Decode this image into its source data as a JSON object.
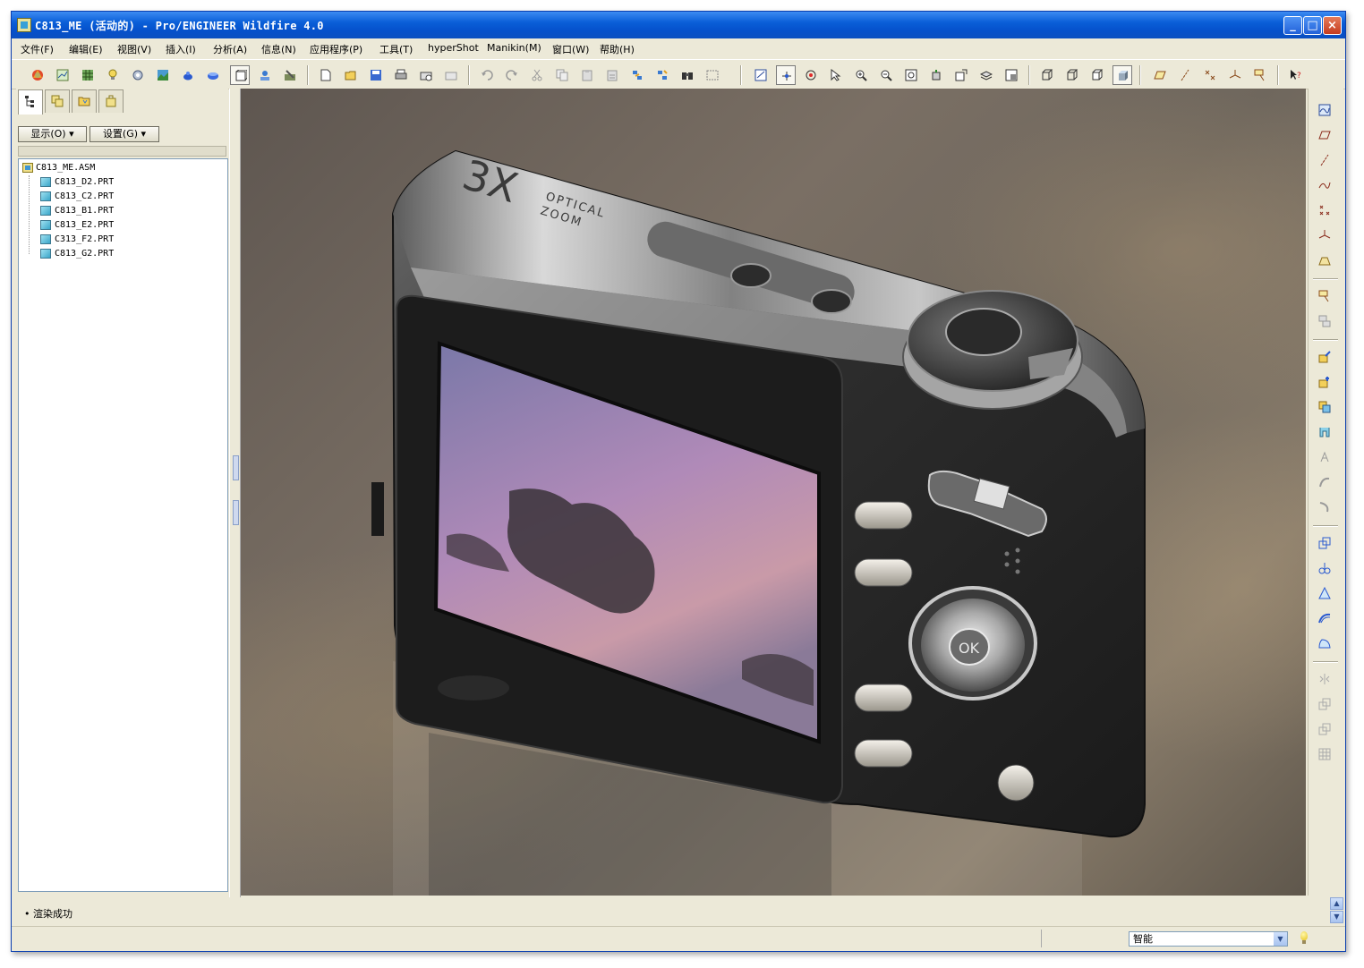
{
  "window": {
    "title": "C813_ME (活动的) - Pro/ENGINEER Wildfire 4.0",
    "controls": [
      "_",
      "□",
      "×"
    ]
  },
  "menu": [
    "文件(F)",
    "编辑(E)",
    "视图(V)",
    "插入(I)",
    "分析(A)",
    "信息(N)",
    "应用程序(P)",
    "工具(T)",
    "hyperShot",
    "Manikin(M)",
    "窗口(W)",
    "帮助(H)"
  ],
  "left_panel": {
    "tabs": [
      "model-tree",
      "layers",
      "folder-browser",
      "favorites"
    ],
    "show_label": "显示(O) ▾",
    "settings_label": "设置(G) ▾",
    "tree": {
      "root": "C813_ME.ASM",
      "children": [
        "C813_D2.PRT",
        "C813_C2.PRT",
        "C813_B1.PRT",
        "C813_E2.PRT",
        "C313_F2.PRT",
        "C813_G2.PRT"
      ]
    }
  },
  "viewport": {
    "model_text_brand": "3X",
    "model_text_line1": "OPTICAL",
    "model_text_line2": "ZOOM",
    "ok_button_text": "OK"
  },
  "message": "• 渲染成功",
  "status": {
    "filter_value": "智能"
  },
  "colors": {
    "titlebar": "#0a5fd8",
    "panel_bg": "#ece9d8",
    "tree_border": "#7f9db9"
  }
}
